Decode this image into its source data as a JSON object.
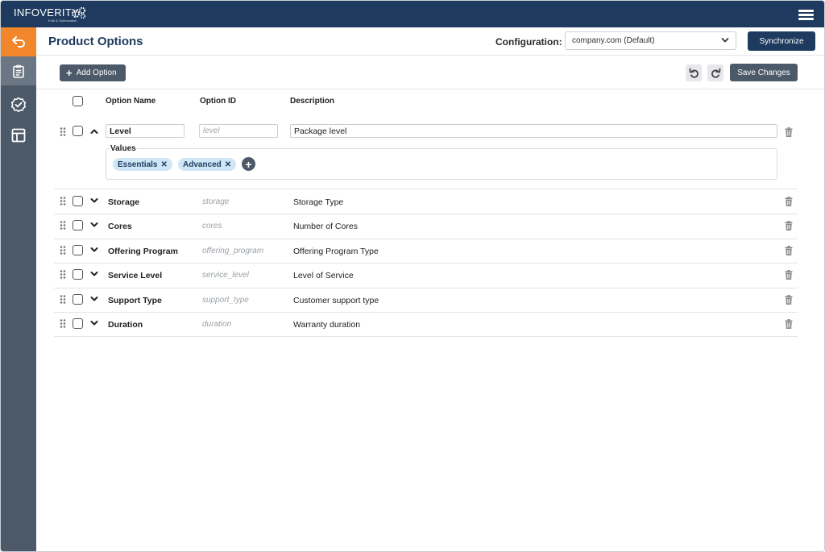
{
  "brand": {
    "name": "INFOVERITY",
    "tagline": "Truth & Optimization"
  },
  "header": {
    "title": "Product Options",
    "config_label": "Configuration:",
    "config_value": "company.com (Default)",
    "sync_label": "Synchronize"
  },
  "toolbar": {
    "add_label": "Add Option",
    "save_label": "Save Changes"
  },
  "columns": {
    "name": "Option Name",
    "id": "Option ID",
    "description": "Description"
  },
  "expanded": {
    "name": "Level",
    "id": "level",
    "description": "Package level",
    "values_label": "Values",
    "values": [
      "Essentials",
      "Advanced"
    ]
  },
  "rows": [
    {
      "name": "Storage",
      "id": "storage",
      "description": "Storage Type"
    },
    {
      "name": "Cores",
      "id": "cores",
      "description": "Number of Cores"
    },
    {
      "name": "Offering Program",
      "id": "offering_program",
      "description": "Offering Program Type"
    },
    {
      "name": "Service Level",
      "id": "service_level",
      "description": "Level of Service"
    },
    {
      "name": "Support Type",
      "id": "support_type",
      "description": "Customer support type"
    },
    {
      "name": "Duration",
      "id": "duration",
      "description": "Warranty duration"
    }
  ],
  "colors": {
    "navy": "#1e3a5f",
    "sidebar": "#4b5968",
    "accent": "#f2862a",
    "chip": "#cfe6f5"
  },
  "icons": [
    "menu-icon",
    "back-arrow-icon",
    "clipboard-icon",
    "badge-check-icon",
    "layout-icon",
    "chevron-down-icon",
    "undo-icon",
    "redo-icon",
    "drag-handle-icon",
    "chevron-up-icon",
    "trash-icon",
    "plus-icon"
  ]
}
